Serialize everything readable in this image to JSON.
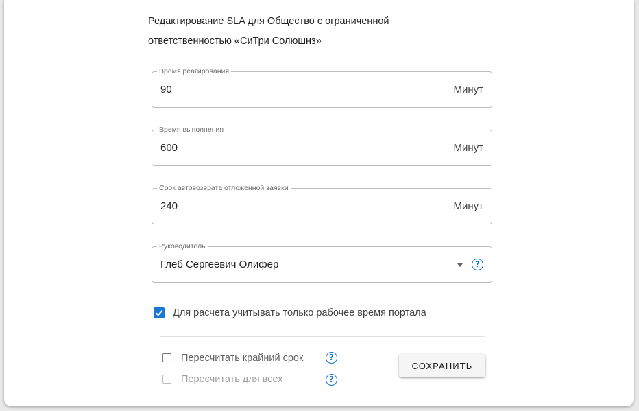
{
  "title": {
    "line1": "Редактирование SLA для Общество с ограниченной",
    "line2": "ответственностью «СиТри Солюшнз»"
  },
  "fields": {
    "response_time": {
      "label": "Время реагирования",
      "value": "90",
      "suffix": "Минут"
    },
    "resolution_time": {
      "label": "Время выполнения",
      "value": "600",
      "suffix": "Минут"
    },
    "auto_return": {
      "label": "Срок автовозврата отложенной заявки",
      "value": "240",
      "suffix": "Минут"
    },
    "manager": {
      "label": "Руководитель",
      "value": "Глеб Сергеевич Олифер"
    }
  },
  "checkboxes": {
    "work_time_only": {
      "label": "Для расчета учитывать только рабочее время портала",
      "checked": true
    },
    "recalc_deadline": {
      "label": "Пересчитать крайний срок",
      "checked": false
    },
    "recalc_all": {
      "label": "Пересчитать для всех",
      "checked": false,
      "disabled": true
    }
  },
  "help_glyph": "?",
  "buttons": {
    "save_label": "СОХРАНИТЬ"
  },
  "colors": {
    "accent": "#1976d2",
    "border": "#bdbdbd",
    "disabled_text": "#9e9e9e"
  },
  "icons": {
    "help": "help-circle-icon",
    "dropdown": "arrow-drop-down-icon",
    "check": "check-icon"
  }
}
